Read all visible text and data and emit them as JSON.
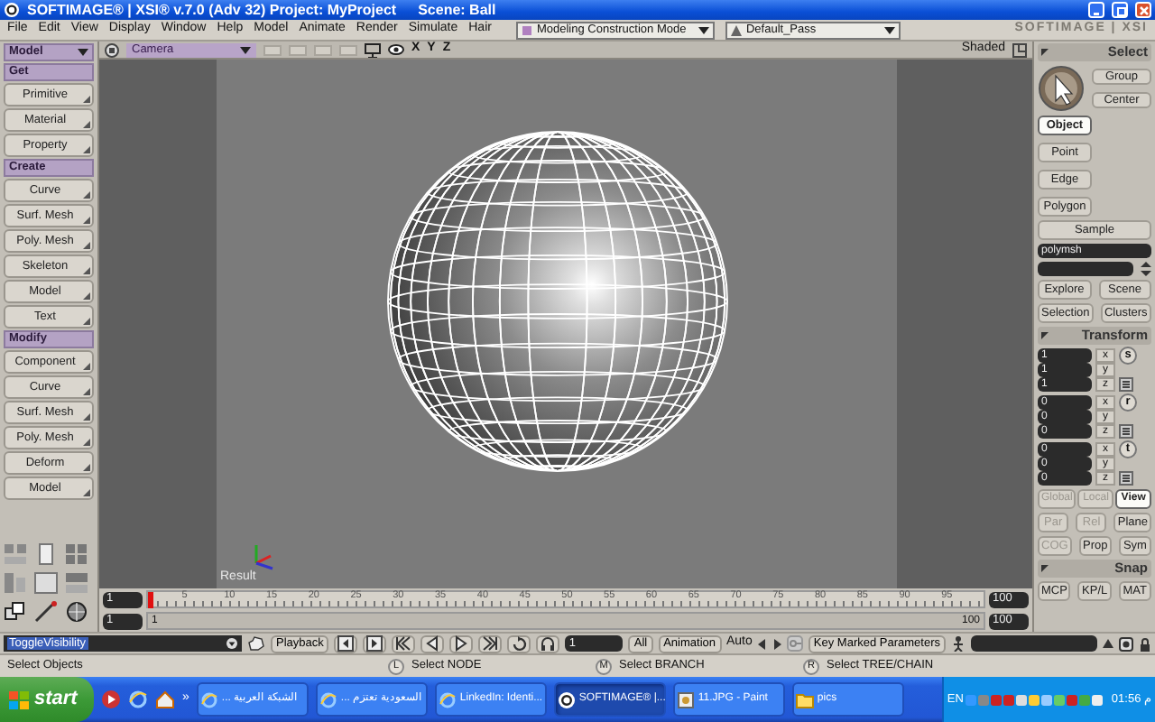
{
  "window": {
    "title": "SOFTIMAGE® | XSI® v.7.0 (Adv 32) Project: MyProject",
    "scene": "Scene: Ball"
  },
  "menu": [
    "File",
    "Edit",
    "View",
    "Display",
    "Window",
    "Help",
    "Model",
    "Animate",
    "Render",
    "Simulate",
    "Hair"
  ],
  "mode_dropdown": "Modeling Construction Mode",
  "pass_dropdown": "Default_Pass",
  "logo": "SOFTIMAGE | XSI",
  "left_panel": {
    "dropdown": "Model",
    "sections": [
      {
        "title": "Get",
        "buttons": [
          "Primitive",
          "Material",
          "Property"
        ]
      },
      {
        "title": "Create",
        "buttons": [
          "Curve",
          "Surf. Mesh",
          "Poly. Mesh",
          "Skeleton",
          "Model",
          "Text"
        ]
      },
      {
        "title": "Modify",
        "buttons": [
          "Component",
          "Curve",
          "Surf. Mesh",
          "Poly. Mesh",
          "Deform",
          "Model"
        ]
      }
    ]
  },
  "viewport": {
    "camera": "Camera",
    "axes": [
      "X",
      "Y",
      "Z"
    ],
    "display_mode": "Shaded",
    "label": "Result"
  },
  "timeline": {
    "start": "1",
    "end": "100",
    "range_start": "1",
    "range_end": "100",
    "range_label_start": "1",
    "range_label_end": "100",
    "ticks": [
      "5",
      "10",
      "15",
      "20",
      "25",
      "30",
      "35",
      "40",
      "45",
      "50",
      "55",
      "60",
      "65",
      "70",
      "75",
      "80",
      "85",
      "90",
      "95"
    ],
    "playhead": {
      "level": 0
    }
  },
  "command_bar": {
    "command": "ToggleVisibility",
    "playback": "Playback",
    "frame": "1",
    "all": "All",
    "animation": "Animation",
    "auto": "Auto",
    "key_marked": "Key Marked Parameters"
  },
  "right_panel": {
    "select_header": "Select",
    "select_buttons": [
      "Group",
      "Center"
    ],
    "filters": [
      {
        "label": "Object",
        "selected": true
      },
      {
        "label": "Point",
        "selected": false
      },
      {
        "label": "Edge",
        "selected": false
      },
      {
        "label": "Polygon",
        "selected": false
      }
    ],
    "sample": "Sample",
    "selection_field": "polymsh",
    "nav_buttons": [
      "Explore",
      "Scene",
      "Selection",
      "Clusters"
    ],
    "transform_header": "Transform",
    "transform_groups": [
      {
        "tool": "s",
        "rows": [
          {
            "value": "1",
            "axis": "x"
          },
          {
            "value": "1",
            "axis": "y"
          },
          {
            "value": "1",
            "axis": "z"
          }
        ]
      },
      {
        "tool": "r",
        "rows": [
          {
            "value": "0",
            "axis": "x"
          },
          {
            "value": "0",
            "axis": "y"
          },
          {
            "value": "0",
            "axis": "z"
          }
        ]
      },
      {
        "tool": "t",
        "rows": [
          {
            "value": "0",
            "axis": "x"
          },
          {
            "value": "0",
            "axis": "y"
          },
          {
            "value": "0",
            "axis": "z"
          }
        ]
      }
    ],
    "reference": [
      {
        "label": "Global",
        "selected": false,
        "disabled": true
      },
      {
        "label": "Local",
        "selected": false,
        "disabled": true
      },
      {
        "label": "View",
        "selected": true,
        "disabled": false
      }
    ],
    "options": [
      {
        "label": "Par",
        "disabled": true
      },
      {
        "label": "Rel",
        "disabled": true
      },
      {
        "label": "Plane",
        "disabled": false
      },
      {
        "label": "COG",
        "disabled": true
      },
      {
        "label": "Prop",
        "disabled": false
      },
      {
        "label": "Sym",
        "disabled": false
      }
    ],
    "snap_header": "Snap",
    "snap_tabs": [
      "MCP",
      "KP/L",
      "MAT"
    ]
  },
  "status_bar": {
    "message": "Select Objects",
    "mouse_hints": [
      {
        "button": "L",
        "text": "Select NODE"
      },
      {
        "button": "M",
        "text": "Select BRANCH"
      },
      {
        "button": "R",
        "text": "Select TREE/CHAIN"
      }
    ]
  },
  "taskbar": {
    "start": "start",
    "more": "»",
    "tasks": [
      {
        "label": "الشبكة العربية ...",
        "kind": "browser",
        "selected": false
      },
      {
        "label": "السعودية تعتزم ...",
        "kind": "browser",
        "selected": false
      },
      {
        "label": "LinkedIn: Identi...",
        "kind": "browser",
        "selected": false
      },
      {
        "label": "SOFTIMAGE® |...",
        "kind": "softimage",
        "selected": true
      },
      {
        "label": "11.JPG - Paint",
        "kind": "paint",
        "selected": false
      },
      {
        "label": "pics",
        "kind": "folder",
        "selected": false
      }
    ],
    "language": "EN",
    "clock": "01:56 م"
  }
}
